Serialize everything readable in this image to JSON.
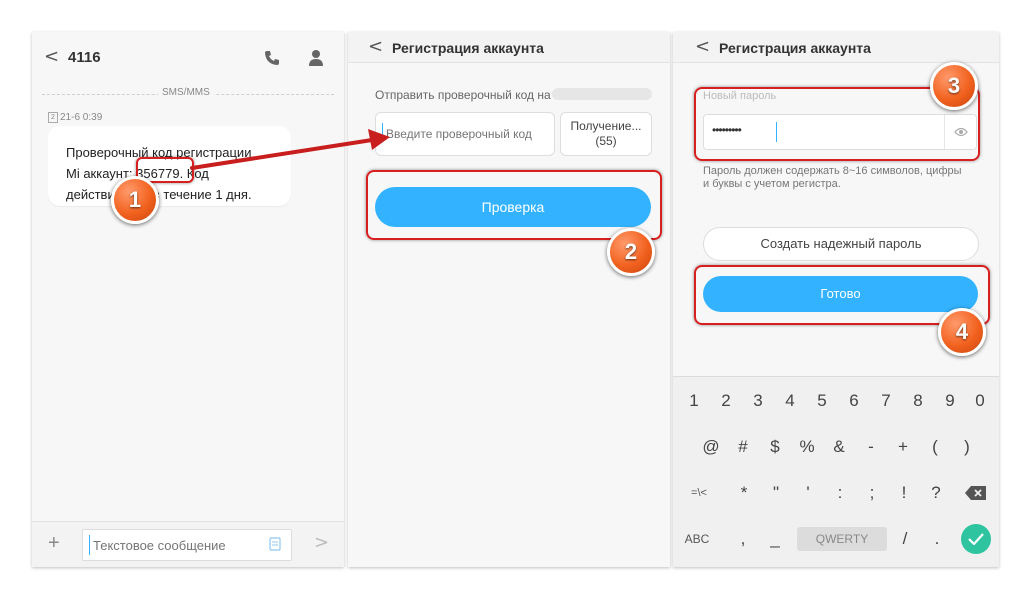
{
  "sms": {
    "contact": "4116",
    "channel": "SMS/MMS",
    "timestamp": "21-6 0:39",
    "sim": "2",
    "message_line1": "Проверочный код регистрации",
    "message_line2_a": "Mi аккаунт: ",
    "code": "356779",
    "message_line2_b": ". Код",
    "message_line3": "действителен в течение 1 дня.",
    "input_placeholder": "Текстовое сообщение"
  },
  "verify": {
    "title": "Регистрация аккаунта",
    "send_label": "Отправить проверочный код на",
    "code_placeholder": "Введите проверочный код",
    "resend_label": "Получение...",
    "resend_count": "(55)",
    "verify_button": "Проверка"
  },
  "password": {
    "title": "Регистрация аккаунта",
    "field_label": "Новый пароль",
    "value": "•••••••••",
    "hint_line1": "Пароль должен содержать 8~16 символов, цифры",
    "hint_line2": "и буквы с учетом регистра.",
    "strong_button": "Создать надежный пароль",
    "done_button": "Готово"
  },
  "keyboard": {
    "row1": [
      "1",
      "2",
      "3",
      "4",
      "5",
      "6",
      "7",
      "8",
      "9",
      "0"
    ],
    "row2": [
      "@",
      "#",
      "$",
      "%",
      "&",
      "-",
      "+",
      "(",
      ")"
    ],
    "row3": [
      "=\\<",
      "*",
      "\"",
      "'",
      ":",
      ";",
      "!",
      "?"
    ],
    "row4_abc": "ABC",
    "row4_comma": ",",
    "row4_underscore": "_",
    "row4_space": "QWERTY",
    "row4_slash": "/",
    "row4_dot": "."
  },
  "badges": [
    "1",
    "2",
    "3",
    "4"
  ],
  "colors": {
    "accent": "#33b3ff",
    "highlight": "#d81f1f",
    "badge": "#f2621f",
    "confirm": "#2ec4a0"
  }
}
